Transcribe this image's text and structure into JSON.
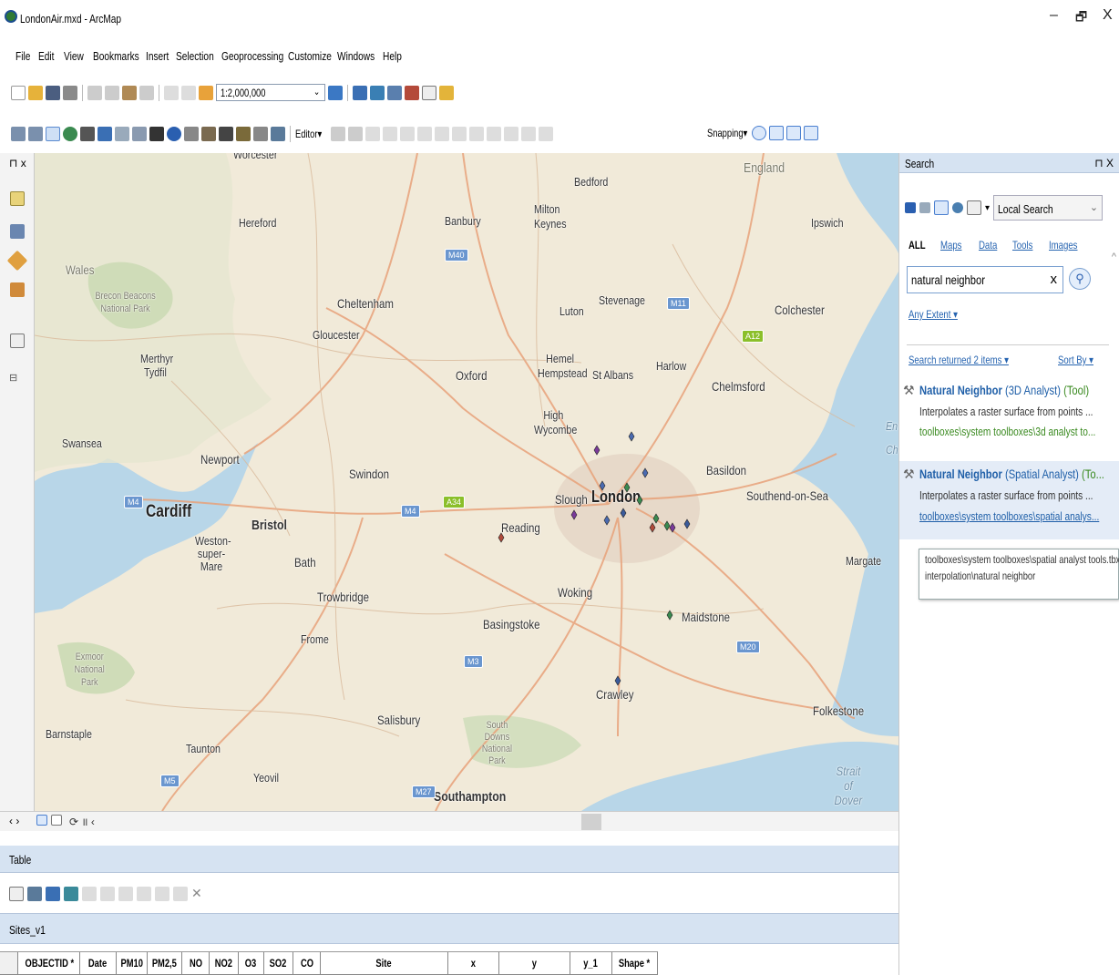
{
  "window": {
    "title": "LondonAir.mxd - ArcMap",
    "minimize": "–",
    "maximize": "🗗",
    "close": "X"
  },
  "menu": [
    "File",
    "Edit",
    "View",
    "Bookmarks",
    "Insert",
    "Selection",
    "Geoprocessing",
    "Customize",
    "Windows",
    "Help"
  ],
  "toolbar": {
    "scale_value": "1:2,000,000",
    "editor_label": "Editor▾",
    "snapping_label": "Snapping▾"
  },
  "toc": {
    "pin": "⊓ x"
  },
  "map": {
    "places": [
      "Worcester",
      "Bedford",
      "England",
      "Hereford",
      "Banbury",
      "Milton Keynes",
      "Ipswich",
      "Wales",
      "Brecon Beacons National Park",
      "Cheltenham",
      "Stevenage",
      "Luton",
      "Colchester",
      "Gloucester",
      "Merthyr Tydfil",
      "Hemel Hempstead",
      "St Albans",
      "Harlow",
      "Oxford",
      "Chelmsford",
      "High Wycombe",
      "Swansea",
      "Newport",
      "Swindon",
      "Basildon",
      "Cardiff",
      "Slough",
      "London",
      "Southend-on-Sea",
      "Bristol",
      "Reading",
      "Weston-super-Mare",
      "Bath",
      "Margate",
      "Trowbridge",
      "Woking",
      "Maidstone",
      "Frome",
      "Basingstoke",
      "Exmoor National Park",
      "Crawley",
      "Salisbury",
      "South Downs National Park",
      "Folkestone",
      "Barnstaple",
      "Taunton",
      "Yeovil",
      "Southampton",
      "Strait of Dover",
      "En",
      "Ch"
    ],
    "shields": [
      "M40",
      "M11",
      "A12",
      "M4",
      "A34",
      "M4",
      "M3",
      "M20",
      "M5",
      "M27",
      "M4"
    ]
  },
  "search": {
    "title": "Search",
    "pin": "⊓ X",
    "location": "Local Search",
    "filters": {
      "all": "ALL",
      "maps": "Maps",
      "data": "Data",
      "tools": "Tools",
      "images": "Images"
    },
    "query": "natural neighbor",
    "clear": "x",
    "extent": "Any Extent ▾",
    "results_count": "Search returned 2 items ▾",
    "sort": "Sort By ▾",
    "results": [
      {
        "name": "Natural Neighbor",
        "toolbox": "(3D Analyst)",
        "kind": "(Tool)",
        "desc": "Interpolates a raster surface from points ...",
        "path": "toolboxes\\system toolboxes\\3d analyst to..."
      },
      {
        "name": "Natural Neighbor",
        "toolbox": "(Spatial Analyst)",
        "kind": "(To...",
        "desc": "Interpolates a raster surface from points ...",
        "path": "toolboxes\\system toolboxes\\spatial analys..."
      }
    ],
    "tooltip": [
      "toolboxes\\system toolboxes\\spatial analyst tools.tbx\\",
      "interpolation\\natural neighbor"
    ]
  },
  "table": {
    "title": "Table",
    "layer": "Sites_v1",
    "columns": [
      "OBJECTID *",
      "Date",
      "PM10",
      "PM2,5",
      "NO",
      "NO2",
      "O3",
      "SO2",
      "CO",
      "Site",
      "x",
      "y",
      "y_1",
      "Shape *"
    ]
  }
}
